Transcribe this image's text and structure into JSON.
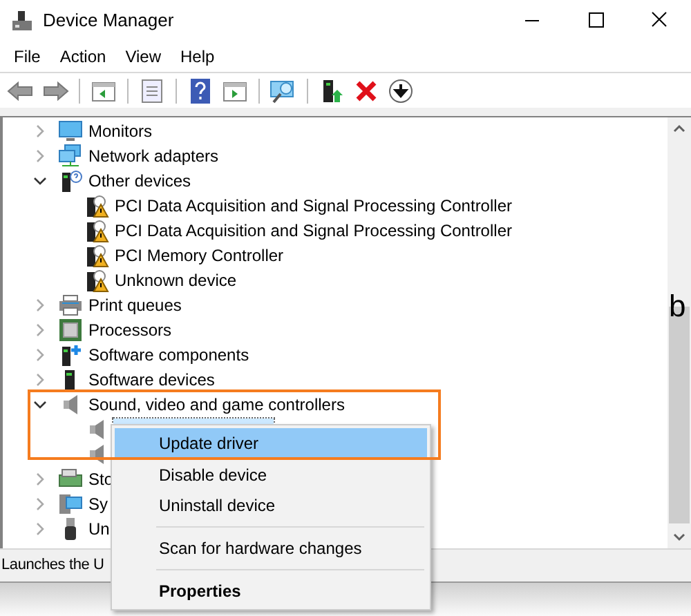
{
  "window": {
    "title": "Device Manager"
  },
  "menu_bar": [
    "File",
    "Action",
    "View",
    "Help"
  ],
  "toolbar": [
    {
      "buttons": [
        {
          "kind": "back"
        },
        {
          "kind": "forward"
        }
      ]
    },
    {
      "buttons": [
        {
          "kind": "console-tree"
        }
      ]
    },
    {
      "buttons": [
        {
          "kind": "properties"
        }
      ]
    },
    {
      "buttons": [
        {
          "kind": "help"
        },
        {
          "kind": "action-pane"
        }
      ]
    },
    {
      "buttons": [
        {
          "kind": "scan"
        }
      ]
    },
    {
      "buttons": [
        {
          "kind": "update"
        },
        {
          "kind": "uninstall"
        },
        {
          "kind": "disable"
        }
      ]
    }
  ],
  "tree": [
    {
      "label": "Monitors",
      "kind": "monitor",
      "expanded": false,
      "selected": false
    },
    {
      "label": "Network adapters",
      "kind": "network",
      "expanded": false,
      "selected": false
    },
    {
      "label": "Other devices",
      "kind": "other",
      "expanded": true,
      "selected": false,
      "children": [
        {
          "label": "PCI Data Acquisition and Signal Processing Controller",
          "kind": "warning",
          "selected": false
        },
        {
          "label": "PCI Data Acquisition and Signal Processing Controller",
          "kind": "warning",
          "selected": false
        },
        {
          "label": "PCI Memory Controller",
          "kind": "warning",
          "selected": false
        },
        {
          "label": "Unknown device",
          "kind": "warning",
          "selected": false
        }
      ]
    },
    {
      "label": "Print queues",
      "kind": "printer",
      "expanded": false,
      "selected": false
    },
    {
      "label": "Processors",
      "kind": "chip",
      "expanded": false,
      "selected": false
    },
    {
      "label": "Software components",
      "kind": "component",
      "expanded": false,
      "selected": false
    },
    {
      "label": "Software devices",
      "kind": "tower",
      "expanded": false,
      "selected": false
    },
    {
      "label": "Sound, video and game controllers",
      "kind": "speaker",
      "expanded": true,
      "selected": false,
      "children": [
        {
          "kind": "speaker",
          "selected": true
        },
        {
          "kind": "speaker",
          "selected": false
        }
      ]
    },
    {
      "label": "Sto",
      "kind": "storage",
      "expanded": false,
      "selected": false
    },
    {
      "label": "Sy",
      "kind": "system",
      "expanded": false,
      "selected": false
    },
    {
      "label": "Un",
      "kind": "usb",
      "expanded": false,
      "selected": false
    }
  ],
  "stray_text": "b",
  "status_bar": "Launches the U",
  "context_menu": [
    {
      "kind": "item",
      "label": "Update driver",
      "selected": true
    },
    {
      "kind": "item",
      "label": "Disable device",
      "selected": false
    },
    {
      "kind": "item",
      "label": "Uninstall device",
      "selected": false
    },
    {
      "kind": "separator"
    },
    {
      "kind": "item",
      "label": "Scan for hardware changes",
      "selected": false
    },
    {
      "kind": "separator"
    },
    {
      "kind": "default",
      "label": "Properties",
      "selected": false
    }
  ]
}
